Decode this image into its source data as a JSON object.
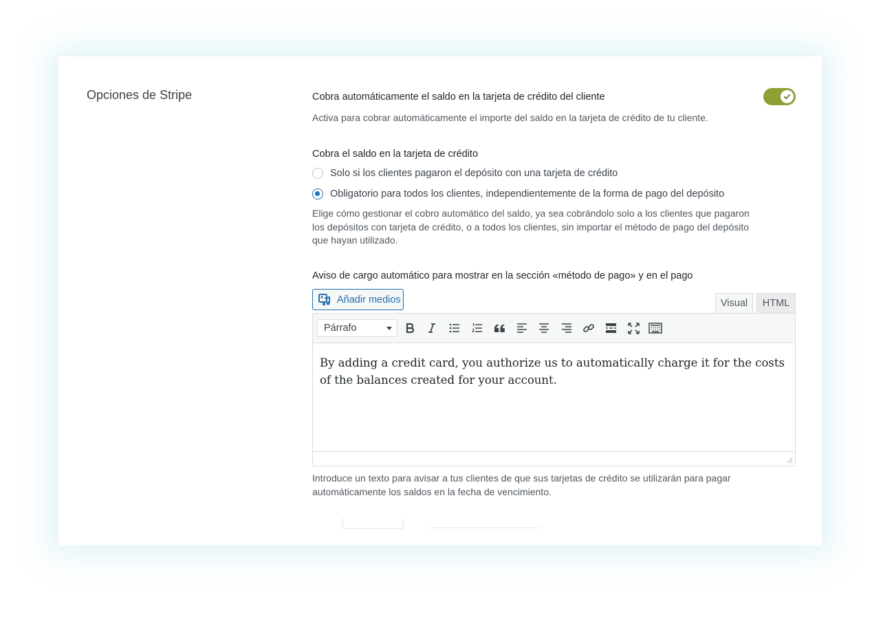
{
  "section": {
    "title": "Opciones de Stripe"
  },
  "auto_charge": {
    "label": "Cobra automáticamente el saldo en la tarjeta de crédito del cliente",
    "enabled": true,
    "help": "Activa para cobrar automáticamente el importe del saldo en la tarjeta de crédito de tu cliente.",
    "toggle_color": "#8da033"
  },
  "charge_mode": {
    "label": "Cobra el saldo en la tarjeta de crédito",
    "options": [
      {
        "label": "Solo si los clientes pagaron el depósito con una tarjeta de crédito",
        "checked": false
      },
      {
        "label": "Obligatorio para todos los clientes, independientemente de la forma de pago del depósito",
        "checked": true
      }
    ],
    "help": "Elige cómo gestionar el cobro automático del saldo, ya sea cobrándolo solo a los clientes que pagaron los depósitos con tarjeta de crédito, o a todos los clientes, sin importar el método de pago del depósito que hayan utilizado."
  },
  "notice": {
    "label": "Aviso de cargo automático para mostrar en la sección «método de pago» y en el pago",
    "add_media_label": "Añadir medios",
    "tabs": {
      "visual": "Visual",
      "html": "HTML"
    },
    "format_value": "Párrafo",
    "toolbar_icons": [
      "bold-icon",
      "italic-icon",
      "bulleted-list-icon",
      "numbered-list-icon",
      "blockquote-icon",
      "align-left-icon",
      "align-center-icon",
      "align-right-icon",
      "link-icon",
      "read-more-icon",
      "fullscreen-icon",
      "toolbar-toggle-icon"
    ],
    "content": "By adding a credit card, you authorize us to automatically charge it for the costs of the balances created for your account.",
    "help": "Introduce un texto para avisar a tus clientes de que sus tarjetas de crédito se utilizarán para pagar automáticamente los saldos en la fecha de vencimiento."
  },
  "colors": {
    "accent": "#2271b1",
    "text": "#1d2327",
    "help": "#50575e"
  }
}
